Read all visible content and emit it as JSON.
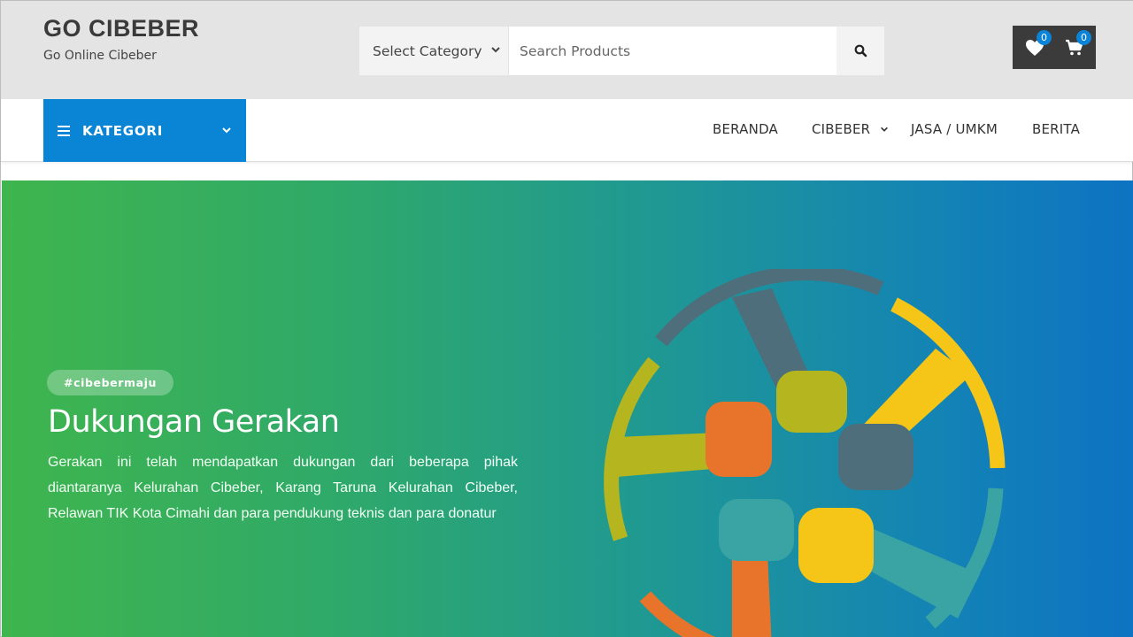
{
  "site": {
    "title": "GO CIBEBER",
    "tagline": "Go Online Cibeber"
  },
  "search": {
    "category_label": "Select Category",
    "placeholder": "Search Products"
  },
  "header_icons": {
    "wishlist_count": "0",
    "cart_count": "0"
  },
  "nav": {
    "kategori_label": "KATEGORI",
    "items": [
      {
        "label": "BERANDA"
      },
      {
        "label": "CIBEBER"
      },
      {
        "label": "JASA / UMKM"
      },
      {
        "label": "BERITA"
      }
    ]
  },
  "hero": {
    "tag": "#cibebermaju",
    "title": "Dukungan Gerakan",
    "text": "Gerakan ini telah mendapatkan dukungan dari beberapa pihak diantaranya Kelurahan Cibeber, Karang Taruna Kelurahan Cibeber, Relawan TIK Kota Cimahi dan para pendukung teknis dan para donatur"
  },
  "colors": {
    "accent_blue": "#0a84d4",
    "dark_button": "#3b3b3b",
    "gradient_start": "#3fb54d",
    "gradient_end": "#0d73c3"
  }
}
